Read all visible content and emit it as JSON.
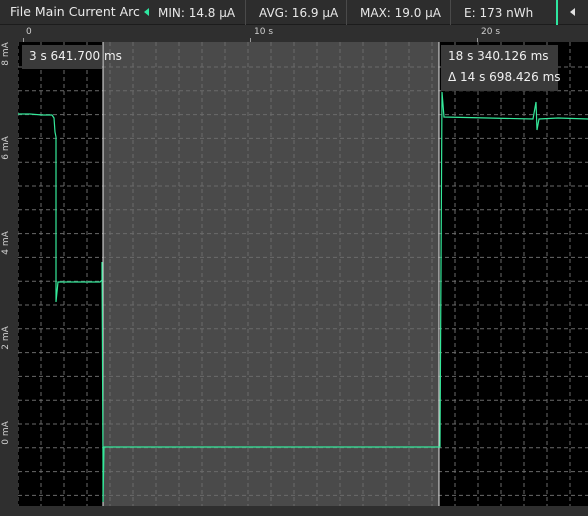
{
  "header": {
    "title": "File Main Current Arc",
    "min": "MIN: 14.8 µA",
    "avg": "AVG: 16.9 µA",
    "max": "MAX: 19.0 µA",
    "energy": "E: 173 nWh"
  },
  "colors": {
    "trace": "#35e89a",
    "accent": "#2ee6a0",
    "selection": "#4a4a4a",
    "plot_bg": "#000000"
  },
  "ruler": {
    "ticks": [
      "0",
      "10 s",
      "20 s"
    ]
  },
  "yaxis": {
    "labels": [
      "8 mA",
      "6 mA",
      "4 mA",
      "2 mA",
      "0 mA"
    ]
  },
  "cursors": {
    "start_time": "3 s 641.700 ms",
    "end_time": "18 s 340.126 ms",
    "delta": "Δ 14 s 698.426 ms"
  },
  "icons": [
    "expand-left-icon",
    "collapse-right-icon"
  ]
}
